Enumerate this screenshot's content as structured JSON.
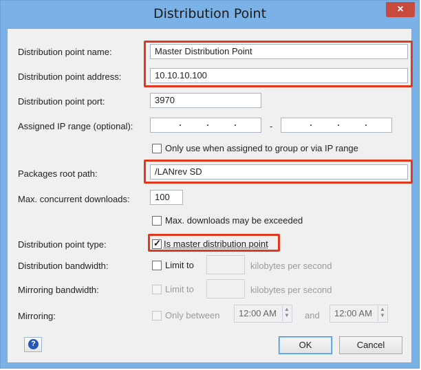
{
  "window": {
    "title": "Distribution Point",
    "close_glyph": "×"
  },
  "form": {
    "name": {
      "label": "Distribution point name:",
      "value": "Master Distribution Point"
    },
    "address": {
      "label": "Distribution point address:",
      "value": "10.10.10.100"
    },
    "port": {
      "label": "Distribution point port:",
      "value": "3970"
    },
    "ip_range": {
      "label": "Assigned IP range (optional):",
      "separator": "-"
    },
    "only_assigned": {
      "label": "Only use when assigned to group or via IP range",
      "checked": false
    },
    "root_path": {
      "label": "Packages root path:",
      "value": "/LANrev SD"
    },
    "max_downloads": {
      "label": "Max. concurrent downloads:",
      "value": "100"
    },
    "may_exceed": {
      "label": "Max. downloads may be exceeded",
      "checked": false
    },
    "type": {
      "label": "Distribution point type:",
      "checkbox_label": "Is master distribution point",
      "checked": true
    },
    "dist_bandwidth": {
      "label": "Distribution bandwidth:",
      "limit_label": "Limit to",
      "unit": "kilobytes per second",
      "checked": false
    },
    "mirror_bandwidth": {
      "label": "Mirroring bandwidth:",
      "limit_label": "Limit to",
      "unit": "kilobytes per second",
      "checked": false,
      "disabled": true
    },
    "mirroring": {
      "label": "Mirroring:",
      "only_between_label": "Only between",
      "start_time": "12:00 AM",
      "and_label": "and",
      "end_time": "12:00 AM",
      "disabled": true
    }
  },
  "buttons": {
    "ok": "OK",
    "cancel": "Cancel",
    "help_glyph": "?"
  },
  "colors": {
    "highlight": "#e03a1e",
    "titlebar": "#7ab1e6",
    "close": "#c74a3f"
  },
  "icons": {
    "help": "help-icon",
    "close": "close-icon",
    "checkmark": "checkmark-icon"
  }
}
